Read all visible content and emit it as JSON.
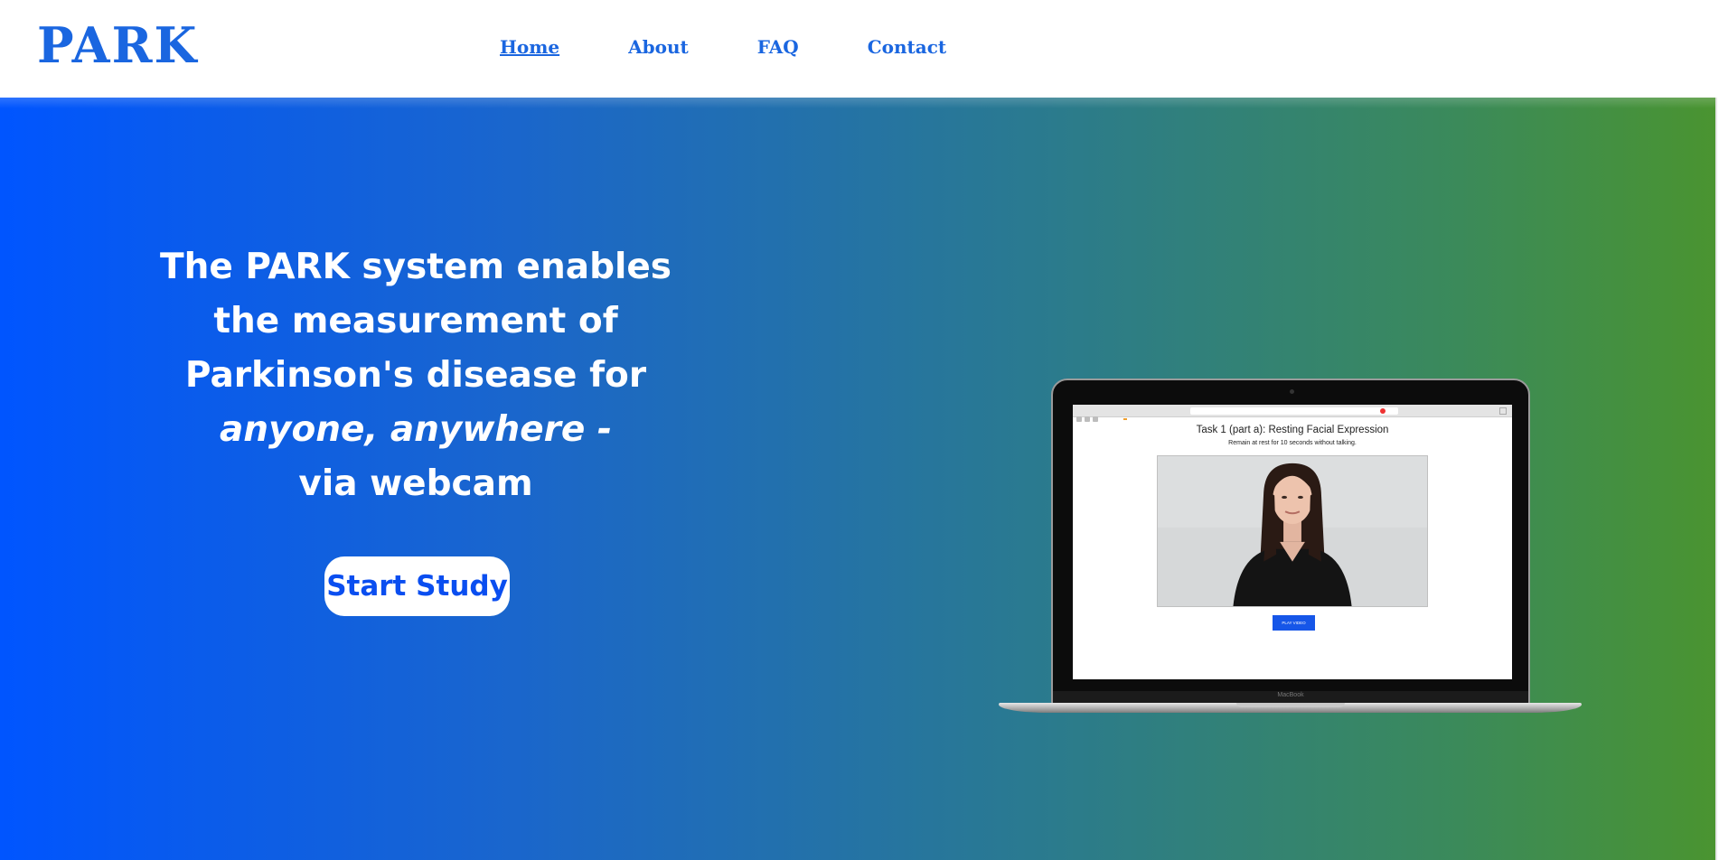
{
  "brand": {
    "logo": "PARK"
  },
  "nav": [
    {
      "label": "Home",
      "active": true
    },
    {
      "label": "About",
      "active": false
    },
    {
      "label": "FAQ",
      "active": false
    },
    {
      "label": "Contact",
      "active": false
    }
  ],
  "hero": {
    "line1": "The PARK system enables",
    "line2": "the measurement of",
    "line3": "Parkinson's disease for",
    "line4_italic": "anyone, anywhere -",
    "line5": "via webcam",
    "cta_label": "Start Study"
  },
  "laptop_screen": {
    "task_title": "Task 1 (part a): Resting Facial Expression",
    "task_subtitle": "Remain at rest for 10 seconds without talking.",
    "play_button": "PLAY VIDEO",
    "device_label": "MacBook"
  },
  "colors": {
    "brand_blue": "#1a66e0",
    "gradient_start": "#0055ff",
    "gradient_end": "#4a9430",
    "button_blue": "#0a4ef0"
  }
}
